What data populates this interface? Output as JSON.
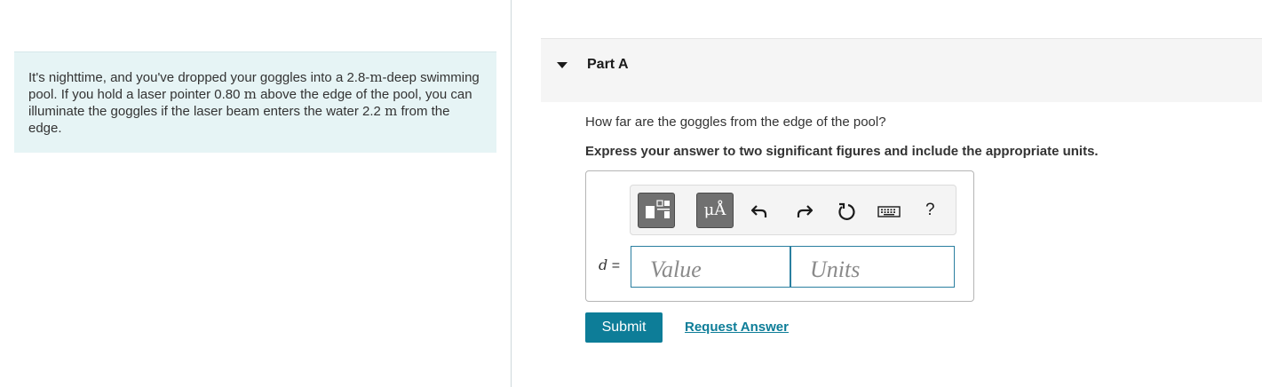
{
  "problem": {
    "text_1": "It's nighttime, and you've dropped your goggles into a 2.8-",
    "unit_1": "m",
    "text_2": "-deep swimming pool. If you hold a laser pointer 0.80 ",
    "unit_2": "m",
    "text_3": " above the edge of the pool, you can illuminate the goggles if the laser beam enters the water 2.2 ",
    "unit_3": "m",
    "text_4": " from the edge."
  },
  "part": {
    "title": "Part A",
    "question": "How far are the goggles from the edge of the pool?",
    "instruction": "Express your answer to two significant figures and include the appropriate units."
  },
  "toolbar": {
    "symbols_label": "μÅ",
    "help_label": "?",
    "icons": [
      "templates-icon",
      "undo-icon",
      "redo-icon",
      "reset-icon",
      "keyboard-icon"
    ]
  },
  "answer": {
    "variable": "d",
    "equals": " =",
    "value_placeholder": "Value",
    "units_placeholder": "Units"
  },
  "actions": {
    "submit_label": "Submit",
    "request_label": "Request Answer"
  },
  "colors": {
    "accent": "#0d7d98",
    "problem_bg": "#e6f4f5",
    "header_bg": "#f5f5f5"
  }
}
